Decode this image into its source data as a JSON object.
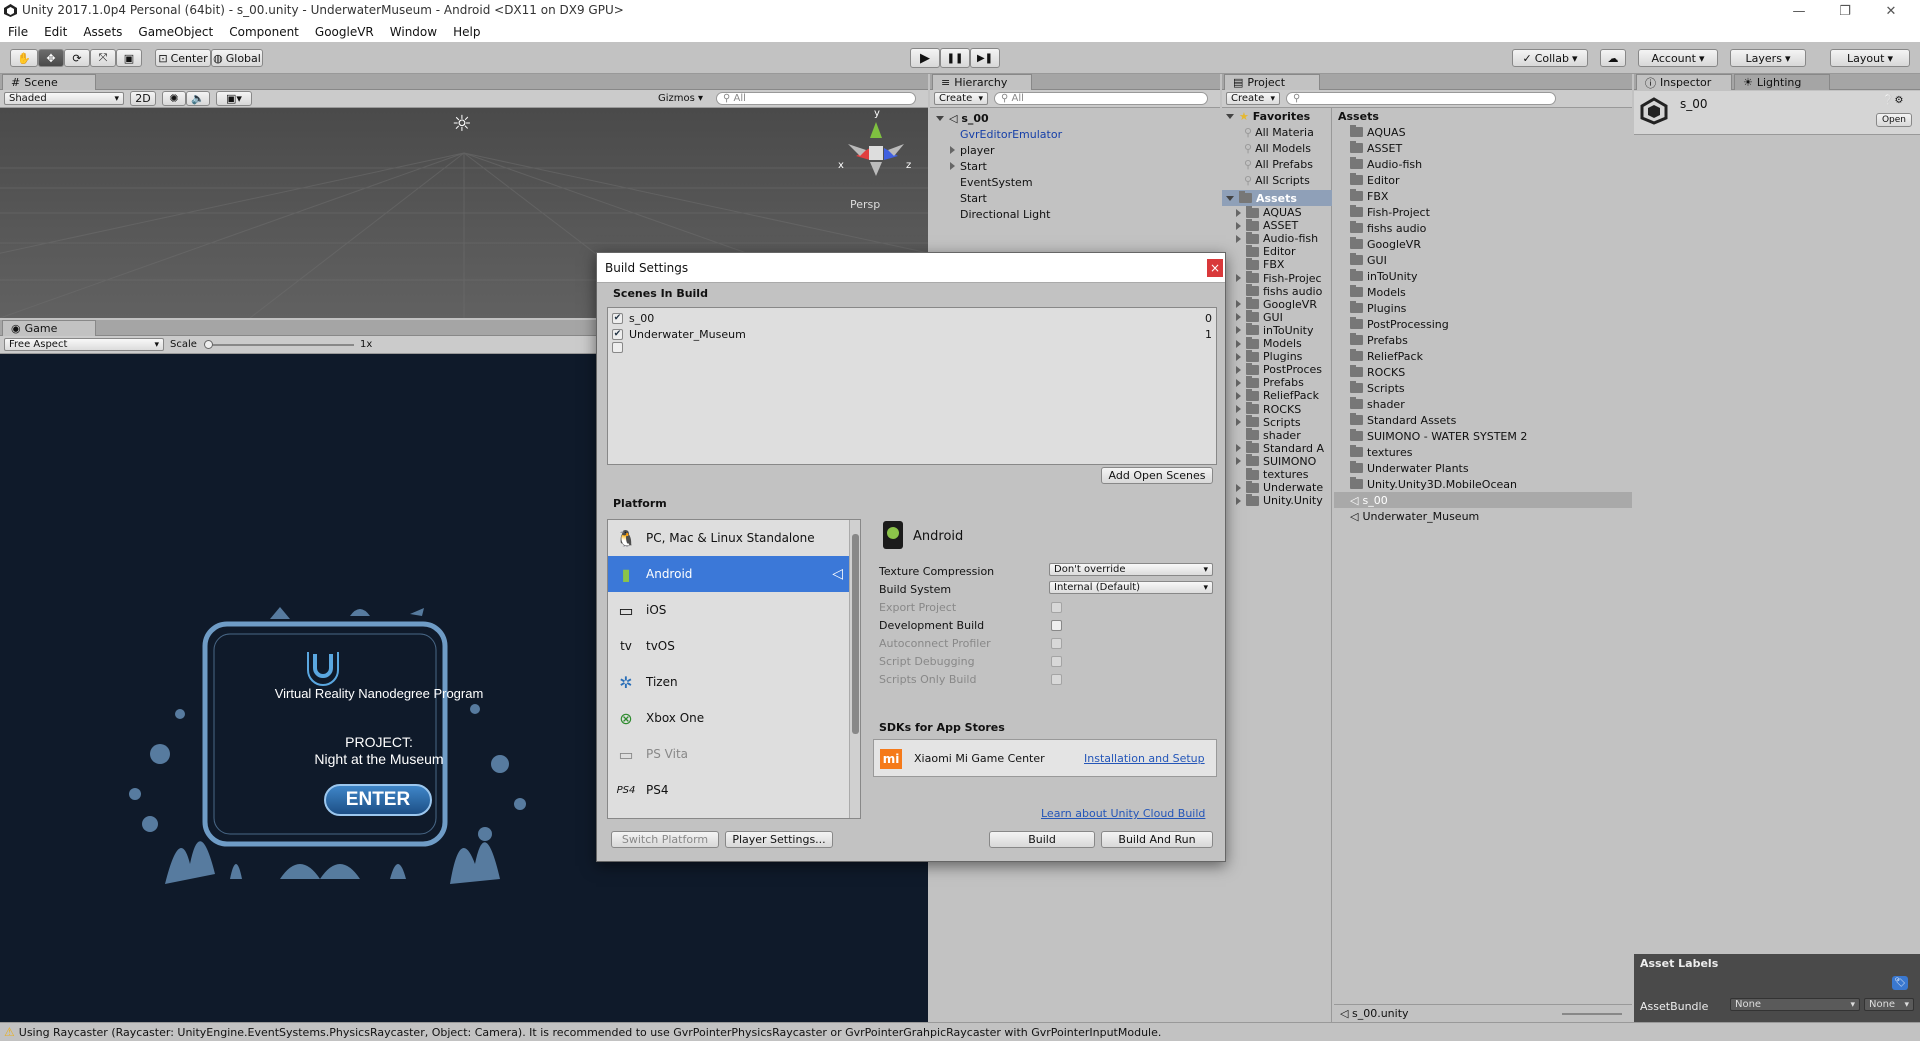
{
  "window": {
    "title": "Unity 2017.1.0p4 Personal (64bit) - s_00.unity - UnderwaterMuseum - Android <DX11 on DX9 GPU>",
    "controls": [
      "—",
      "❐",
      "✕"
    ]
  },
  "menu": [
    "File",
    "Edit",
    "Assets",
    "GameObject",
    "Component",
    "GoogleVR",
    "Window",
    "Help"
  ],
  "toolbar": {
    "tools": [
      "hand-tool",
      "move-tool",
      "rotate-tool",
      "scale-tool",
      "rect-tool"
    ],
    "pivot": "Center",
    "space": "Global",
    "play": "▶",
    "pause": "❚❚",
    "step": "▶❚",
    "collab": "Collab",
    "account": "Account",
    "layers": "Layers",
    "layout": "Layout"
  },
  "scene": {
    "tab": "Scene",
    "shading": "Shaded",
    "mode2d": "2D",
    "gizmos": "Gizmos",
    "search_placeholder": "All",
    "persp": "Persp",
    "axis_y": "y",
    "axis_x": "x",
    "axis_z": "z"
  },
  "game": {
    "tab": "Game",
    "aspect": "Free Aspect",
    "scale_label": "Scale",
    "scale_value": "1x",
    "scale_fraction": 0.0,
    "card_line1": "Virtual Reality Nanodegree Program",
    "card_line2": "PROJECT:",
    "card_line3": "Night at the Museum",
    "enter": "ENTER"
  },
  "hierarchy": {
    "tab": "Hierarchy",
    "create": "Create",
    "search_placeholder": "All",
    "scene_name": "s_00",
    "items": [
      "GvrEditorEmulator",
      "player",
      "Start",
      "EventSystem",
      "Start",
      "Directional Light"
    ]
  },
  "project": {
    "tab": "Project",
    "create": "Create",
    "favorites_label": "Favorites",
    "favorites": [
      "All Materia",
      "All Models",
      "All Prefabs",
      "All Scripts"
    ],
    "assets_label": "Assets",
    "tree": [
      "AQUAS",
      "ASSET",
      "Audio-fish",
      "Editor",
      "FBX",
      "Fish-Projec",
      "fishs audio",
      "GoogleVR",
      "GUI",
      "inToUnity",
      "Models",
      "Plugins",
      "PostProces",
      "Prefabs",
      "ReliefPack",
      "ROCKS",
      "Scripts",
      "shader",
      "Standard A",
      "SUIMONO",
      "textures",
      "Underwate",
      "Unity.Unity"
    ],
    "list_header": "Assets",
    "list": [
      "AQUAS",
      "ASSET",
      "Audio-fish",
      "Editor",
      "FBX",
      "Fish-Project",
      "fishs audio",
      "GoogleVR",
      "GUI",
      "inToUnity",
      "Models",
      "Plugins",
      "PostProcessing",
      "Prefabs",
      "ReliefPack",
      "ROCKS",
      "Scripts",
      "shader",
      "Standard Assets",
      "SUIMONO - WATER SYSTEM 2",
      "textures",
      "Underwater Plants",
      "Unity.Unity3D.MobileOcean"
    ],
    "scenes": [
      "s_00",
      "Underwater_Museum"
    ],
    "footer_file": "s_00.unity"
  },
  "inspector": {
    "tab": "Inspector",
    "tab2": "Lighting",
    "asset_name": "s_00",
    "open": "Open",
    "asset_labels": "Asset Labels",
    "asset_bundle_label": "AssetBundle",
    "bundle_value": "None",
    "bundle_variant": "None"
  },
  "build": {
    "title": "Build Settings",
    "close": "×",
    "scenes_header": "Scenes In Build",
    "scenes": [
      {
        "name": "s_00",
        "index": "0",
        "checked": true
      },
      {
        "name": "Underwater_Museum",
        "index": "1",
        "checked": true
      }
    ],
    "add_open_scenes": "Add Open Scenes",
    "platform_header": "Platform",
    "platforms": [
      {
        "name": "PC, Mac & Linux Standalone",
        "icon": "pc-icon"
      },
      {
        "name": "Android",
        "icon": "android-icon",
        "selected": true
      },
      {
        "name": "iOS",
        "icon": "ios-icon"
      },
      {
        "name": "tvOS",
        "icon": "tvos-icon"
      },
      {
        "name": "Tizen",
        "icon": "tizen-icon"
      },
      {
        "name": "Xbox One",
        "icon": "xbox-icon"
      },
      {
        "name": "PS Vita",
        "icon": "psvita-icon"
      },
      {
        "name": "PS4",
        "icon": "ps4-icon"
      }
    ],
    "apple_glyph": "",
    "tv_glyph": "tv",
    "ps4_glyph": "PS4",
    "platform_title": "Android",
    "texture_compression_label": "Texture Compression",
    "texture_compression": "Don't override",
    "build_system_label": "Build System",
    "build_system": "Internal (Default)",
    "options": [
      "Export Project",
      "Development Build",
      "Autoconnect Profiler",
      "Script Debugging",
      "Scripts Only Build"
    ],
    "sdk_header": "SDKs for App Stores",
    "sdk_name": "Xiaomi Mi Game Center",
    "sdk_link": "Installation and Setup",
    "cloud_link": "Learn about Unity Cloud Build",
    "switch_platform": "Switch Platform",
    "player_settings": "Player Settings...",
    "build_btn": "Build",
    "build_run": "Build And Run"
  },
  "status": {
    "message": "Using Raycaster (Raycaster: UnityEngine.EventSystems.PhysicsRaycaster, Object: Camera). It is recommended to use GvrPointerPhysicsRaycaster or GvrPointerGrahpicRaycaster with GvrPointerInputModule."
  }
}
